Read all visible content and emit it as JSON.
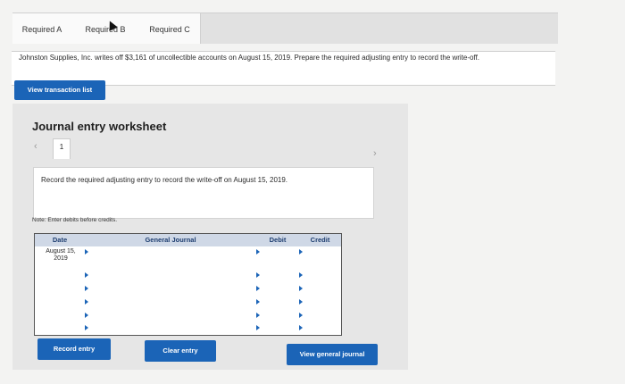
{
  "tabs": [
    {
      "label": "Required A"
    },
    {
      "label": "Required B"
    },
    {
      "label": "Required C"
    }
  ],
  "question": {
    "text": "Johnston Supplies, Inc. writes off $3,161 of uncollectible accounts on August 15, 2019. Prepare the required adjusting entry to record the write-off."
  },
  "buttons": {
    "view_transaction_list": "View transaction list",
    "record_entry": "Record entry",
    "clear_entry": "Clear entry",
    "view_general_journal": "View general journal"
  },
  "worksheet": {
    "title": "Journal entry worksheet",
    "prev_icon": "‹",
    "next_icon": "›",
    "page": "1",
    "instruction": "Record the required adjusting entry to record the write-off on August 15, 2019.",
    "note": "Note: Enter debits before credits."
  },
  "journal": {
    "headers": {
      "date": "Date",
      "general_journal": "General Journal",
      "debit": "Debit",
      "credit": "Credit"
    },
    "rows": [
      {
        "date": "August 15, 2019",
        "account": "",
        "debit": "",
        "credit": ""
      },
      {
        "date": "",
        "account": "",
        "debit": "",
        "credit": ""
      },
      {
        "date": "",
        "account": "",
        "debit": "",
        "credit": ""
      },
      {
        "date": "",
        "account": "",
        "debit": "",
        "credit": ""
      },
      {
        "date": "",
        "account": "",
        "debit": "",
        "credit": ""
      },
      {
        "date": "",
        "account": "",
        "debit": "",
        "credit": ""
      }
    ]
  },
  "colors": {
    "accent": "#1b64b7",
    "header_bg": "#cfd8e6"
  }
}
